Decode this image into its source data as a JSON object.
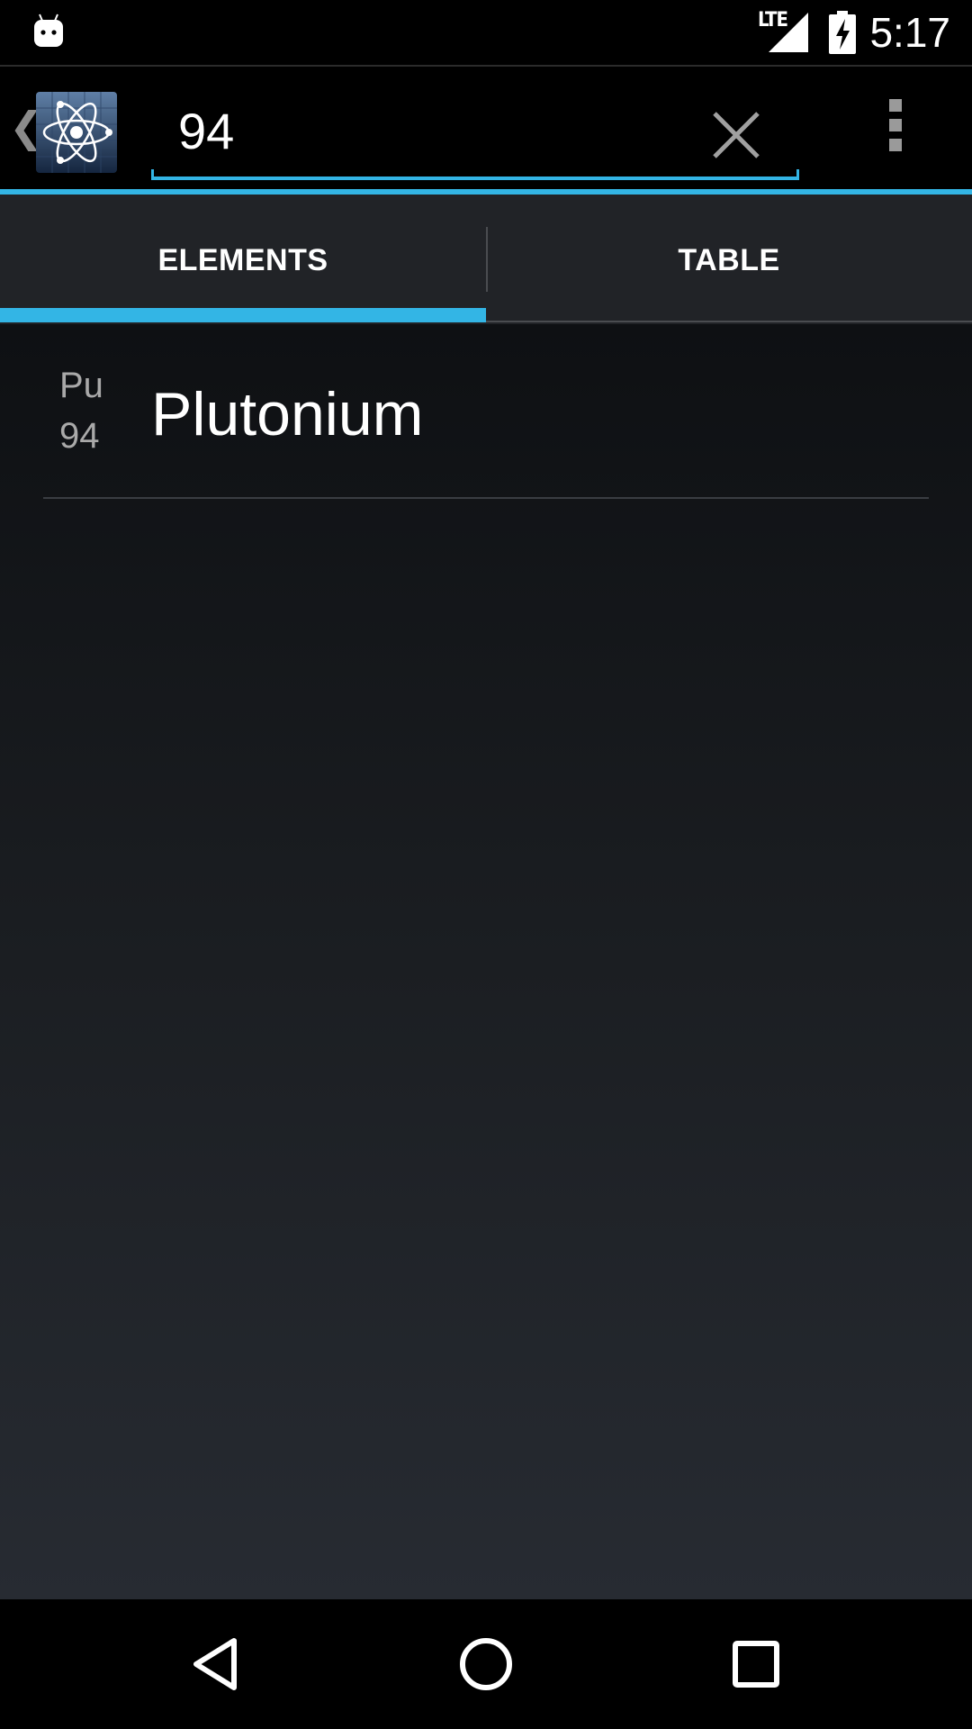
{
  "status_bar": {
    "network_label": "LTE",
    "clock": "5:17",
    "icons": [
      "android-notification-icon",
      "signal-icon",
      "battery-charging-icon"
    ]
  },
  "action_bar": {
    "up_icon": "chevron-left-icon",
    "app_icon": "atom-icon",
    "search": {
      "value": "94"
    },
    "clear_icon": "close-icon",
    "overflow_icon": "overflow-menu-icon"
  },
  "tabs": [
    {
      "label": "ELEMENTS",
      "selected": true
    },
    {
      "label": "TABLE",
      "selected": false
    }
  ],
  "results": [
    {
      "symbol": "Pu",
      "number": "94",
      "name": "Plutonium"
    }
  ],
  "navigation": {
    "icons": [
      "back-icon",
      "home-icon",
      "recent-apps-icon"
    ]
  },
  "colors": {
    "accent": "#33b5e5",
    "tab_background": "#212327",
    "bar_background": "#000000"
  }
}
